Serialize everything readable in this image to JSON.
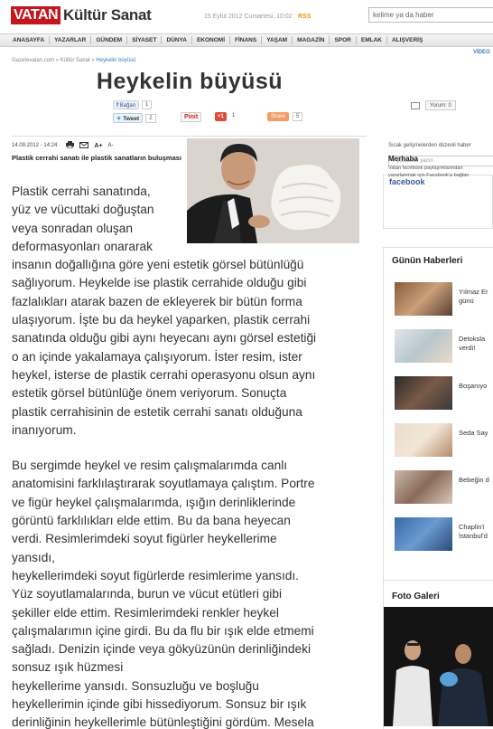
{
  "header": {
    "logo_brand": "VATAN",
    "logo_section": "Kültür Sanat",
    "date": "15 Eylül 2012 Cumartesi, 10:02",
    "rss": "RSS",
    "search_value": "kelime ya da haber"
  },
  "nav": [
    "ANASAYFA",
    "YAZARLAR",
    "GÜNDEM",
    "SİYASET",
    "DÜNYA",
    "EKONOMİ",
    "FİNANS",
    "YAŞAM",
    "MAGAZİN",
    "SPOR",
    "EMLAK",
    "ALIŞVERİŞ"
  ],
  "breadcrumb": {
    "home": "Gazetevatan.com",
    "sep": " » ",
    "section": "Kültür Sanat",
    "current": "Heykelin büyüsü"
  },
  "video_link": "VİDEO",
  "article": {
    "title": "Heykelin büyüsü",
    "date": "14.09.2012 - 14:24",
    "font_larger": "A+",
    "font_smaller": "A-",
    "subtitle": "Plastik cerrahi sanatı ile plastik sanatların buluşması",
    "paragraph1": "Plastik cerrahi sanatında,\nyüz ve vücuttaki doğuştan\nveya sonradan oluşan\ndeformasyonları onararak\ninsanın doğallığına göre yeni estetik görsel bütünlüğü\nsağlıyorum. Heykelde ise plastik cerrahide olduğu gibi\nfazlalıkları atarak bazen de ekleyerek bir bütün forma\nulaşıyorum. İşte bu da heykel yaparken, plastik cerrahi\nsanatında olduğu gibi aynı heyecanı aynı görsel estetiği\no an içinde yakalamaya çalışıyorum. İster resim, ister\nheykel, isterse de plastik cerrahi operasyonu olsun aynı\nestetik görsel bütünlüğe önem veriyorum. Sonuçta\nplastik cerrahisinin de estetik cerrahi sanatı olduğuna\ninanıyorum.",
    "paragraph2": "Bu sergimde heykel ve resim çalışmalarımda canlı\nanatomisini farklılaştırarak soyutlamaya çalıştım. Portre\nve figür heykel çalışmalarımda, ışığın derinliklerinde\ngörüntü farklılıkları elde ettim. Bu da bana heyecan\nverdi. Resimlerimdeki soyut figürler heykellerime\nyansıdı,\nheykellerimdeki soyut figürlerde resimlerime yansıdı.\nYüz soyutlamalarında, burun ve vücut etütleri gibi\nşekiller elde ettim. Resimlerimdeki renkler heykel\nçalışmalarımın içine girdi. Bu da flu bir ışık elde etmemi\nsağladı. Denizin içinde veya gökyüzünün derinliğindeki\nsonsuz ışık hüzmesi\nheykellerime yansıdı. Sonsuzluğu ve boşluğu\nheykellerimin içinde gibi hissediyorum. Sonsuz bir ışık\nderinliğinin heykellerimle bütünleştiğini gördüm. Mesela"
  },
  "social": {
    "fb_label": "Bağan",
    "fb_count": "1",
    "tweet_label": "Tweet",
    "tweet_count": "2",
    "pin_label": "Pinit",
    "gplus_label": "+1",
    "gplus_count": "1",
    "share_label": "Share",
    "share_count": "5",
    "comments_label": "Yorum: 0"
  },
  "sidebar": {
    "newsletter_label": "Sıcak gelişmelerden düzenli haber",
    "newsletter_placeholder": "e-postanızı yazın",
    "facebook_title": "facebook",
    "facebook_hello": "Merhaba",
    "facebook_desc_1": "Vatan facebook paylaşımlarından",
    "facebook_desc_2": "yararlanmak için Facebook'a bağlan",
    "news_title": "Günün Haberleri",
    "news_items": [
      {
        "label_1": "Yılmaz Er",
        "label_2": "günü"
      },
      {
        "label_1": "Detoksla",
        "label_2": "verdi!"
      },
      {
        "label_1": "Boşanıyo",
        "label_2": ""
      },
      {
        "label_1": "Seda Say",
        "label_2": ""
      },
      {
        "label_1": "Bebeğin d",
        "label_2": ""
      },
      {
        "label_1": "Chaplin'i",
        "label_2": "İstanbul'd"
      }
    ],
    "gallery_title": "Foto Galeri"
  },
  "colors": {
    "brand_red": "#c4161c",
    "link_blue": "#3a7abf",
    "facebook_blue": "#3b5998"
  }
}
